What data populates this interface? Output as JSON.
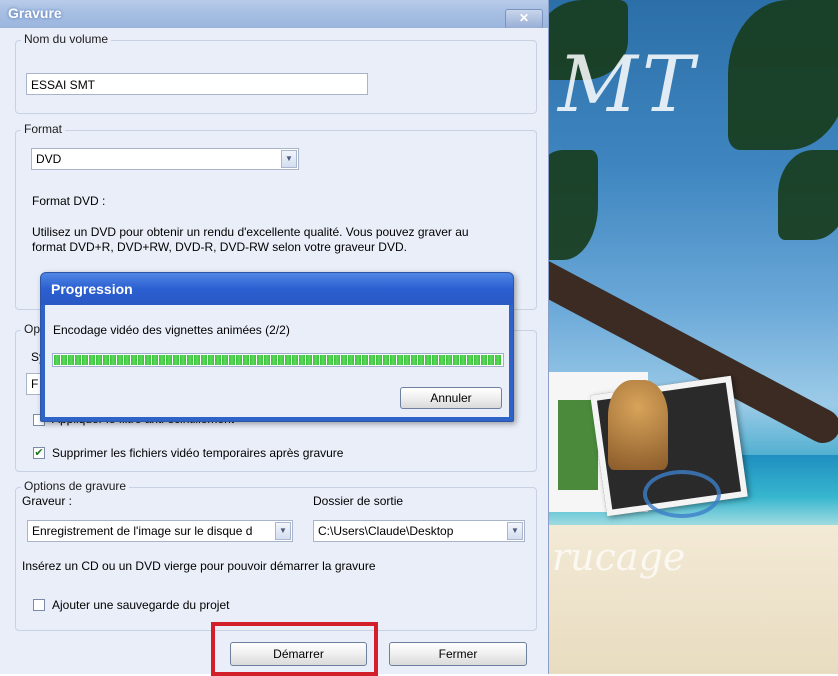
{
  "window": {
    "title": "Gravure",
    "close_label": "✕"
  },
  "volume": {
    "legend": "Nom du volume",
    "value": "ESSAI SMT"
  },
  "format": {
    "legend": "Format",
    "selected": "DVD",
    "heading": "Format DVD :",
    "description_line1": "Utilisez un DVD pour obtenir un rendu d'excellente qualité. Vous pouvez graver au",
    "description_line2": "format DVD+R, DVD+RW, DVD-R, DVD-RW selon votre graveur DVD."
  },
  "options": {
    "legend_fragment": "Op",
    "label_fragment": "Sy",
    "combo_fragment": "F",
    "filter_label": "Appliquer le filtre anti-scintillement",
    "delete_temp_label": "Supprimer les fichiers vidéo temporaires après gravure",
    "delete_temp_checked": true
  },
  "burn": {
    "legend": "Options de gravure",
    "graveur_label": "Graveur :",
    "graveur_value": "Enregistrement de l'image sur le disque d",
    "output_label": "Dossier de sortie",
    "output_value": "C:\\Users\\Claude\\Desktop",
    "insert_msg": "Insérez un CD ou un DVD vierge pour pouvoir démarrer la gravure",
    "backup_label": "Ajouter une sauvegarde du projet",
    "backup_checked": false
  },
  "buttons": {
    "start": "Démarrer",
    "close": "Fermer"
  },
  "progress": {
    "title": "Progression",
    "message": "Encodage vidéo des vignettes animées (2/2)",
    "percent": 100,
    "cancel": "Annuler"
  },
  "background": {
    "title_text": "MT",
    "sub_text": "rucage"
  }
}
